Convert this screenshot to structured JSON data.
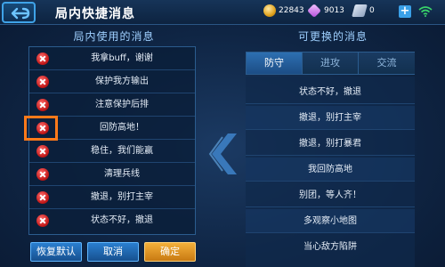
{
  "header": {
    "title": "局内快捷消息",
    "coins": "22843",
    "gems": "9013",
    "tickets": "0",
    "plus_label": "+"
  },
  "left_panel": {
    "title": "局内使用的消息",
    "messages": [
      "我拿buff，谢谢",
      "保护我方输出",
      "注意保护后排",
      "回防高地！",
      "稳住，我们能赢",
      "清理兵线",
      "撤退，别打主宰",
      "状态不好，撤退"
    ]
  },
  "right_panel": {
    "title": "可更换的消息",
    "tabs": [
      "防守",
      "进攻",
      "交流"
    ],
    "active_tab": "防守",
    "messages": [
      "状态不好，撤退",
      "撤退，别打主宰",
      "撤退，别打暴君",
      "我回防高地",
      "别团，等人齐！",
      "多观察小地图",
      "当心敌方陷阱"
    ]
  },
  "buttons": {
    "reset": "恢复默认",
    "cancel": "取消",
    "confirm": "确定"
  },
  "colors": {
    "accent_blue": "#2a7fd0",
    "confirm_orange": "#f4b03a",
    "highlight_orange": "#ff7a1a",
    "delete_red": "#c41919"
  }
}
